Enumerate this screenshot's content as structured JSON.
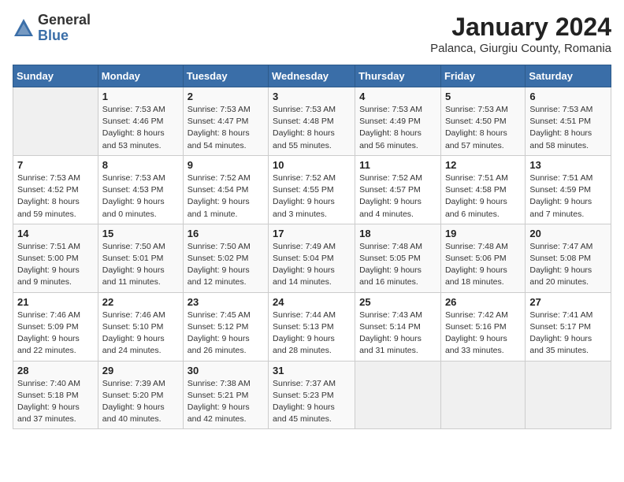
{
  "header": {
    "logo": {
      "general": "General",
      "blue": "Blue"
    },
    "title": "January 2024",
    "subtitle": "Palanca, Giurgiu County, Romania"
  },
  "calendar": {
    "days_of_week": [
      "Sunday",
      "Monday",
      "Tuesday",
      "Wednesday",
      "Thursday",
      "Friday",
      "Saturday"
    ],
    "weeks": [
      [
        {
          "day": "",
          "info": ""
        },
        {
          "day": "1",
          "info": "Sunrise: 7:53 AM\nSunset: 4:46 PM\nDaylight: 8 hours\nand 53 minutes."
        },
        {
          "day": "2",
          "info": "Sunrise: 7:53 AM\nSunset: 4:47 PM\nDaylight: 8 hours\nand 54 minutes."
        },
        {
          "day": "3",
          "info": "Sunrise: 7:53 AM\nSunset: 4:48 PM\nDaylight: 8 hours\nand 55 minutes."
        },
        {
          "day": "4",
          "info": "Sunrise: 7:53 AM\nSunset: 4:49 PM\nDaylight: 8 hours\nand 56 minutes."
        },
        {
          "day": "5",
          "info": "Sunrise: 7:53 AM\nSunset: 4:50 PM\nDaylight: 8 hours\nand 57 minutes."
        },
        {
          "day": "6",
          "info": "Sunrise: 7:53 AM\nSunset: 4:51 PM\nDaylight: 8 hours\nand 58 minutes."
        }
      ],
      [
        {
          "day": "7",
          "info": "Sunrise: 7:53 AM\nSunset: 4:52 PM\nDaylight: 8 hours\nand 59 minutes."
        },
        {
          "day": "8",
          "info": "Sunrise: 7:53 AM\nSunset: 4:53 PM\nDaylight: 9 hours\nand 0 minutes."
        },
        {
          "day": "9",
          "info": "Sunrise: 7:52 AM\nSunset: 4:54 PM\nDaylight: 9 hours\nand 1 minute."
        },
        {
          "day": "10",
          "info": "Sunrise: 7:52 AM\nSunset: 4:55 PM\nDaylight: 9 hours\nand 3 minutes."
        },
        {
          "day": "11",
          "info": "Sunrise: 7:52 AM\nSunset: 4:57 PM\nDaylight: 9 hours\nand 4 minutes."
        },
        {
          "day": "12",
          "info": "Sunrise: 7:51 AM\nSunset: 4:58 PM\nDaylight: 9 hours\nand 6 minutes."
        },
        {
          "day": "13",
          "info": "Sunrise: 7:51 AM\nSunset: 4:59 PM\nDaylight: 9 hours\nand 7 minutes."
        }
      ],
      [
        {
          "day": "14",
          "info": "Sunrise: 7:51 AM\nSunset: 5:00 PM\nDaylight: 9 hours\nand 9 minutes."
        },
        {
          "day": "15",
          "info": "Sunrise: 7:50 AM\nSunset: 5:01 PM\nDaylight: 9 hours\nand 11 minutes."
        },
        {
          "day": "16",
          "info": "Sunrise: 7:50 AM\nSunset: 5:02 PM\nDaylight: 9 hours\nand 12 minutes."
        },
        {
          "day": "17",
          "info": "Sunrise: 7:49 AM\nSunset: 5:04 PM\nDaylight: 9 hours\nand 14 minutes."
        },
        {
          "day": "18",
          "info": "Sunrise: 7:48 AM\nSunset: 5:05 PM\nDaylight: 9 hours\nand 16 minutes."
        },
        {
          "day": "19",
          "info": "Sunrise: 7:48 AM\nSunset: 5:06 PM\nDaylight: 9 hours\nand 18 minutes."
        },
        {
          "day": "20",
          "info": "Sunrise: 7:47 AM\nSunset: 5:08 PM\nDaylight: 9 hours\nand 20 minutes."
        }
      ],
      [
        {
          "day": "21",
          "info": "Sunrise: 7:46 AM\nSunset: 5:09 PM\nDaylight: 9 hours\nand 22 minutes."
        },
        {
          "day": "22",
          "info": "Sunrise: 7:46 AM\nSunset: 5:10 PM\nDaylight: 9 hours\nand 24 minutes."
        },
        {
          "day": "23",
          "info": "Sunrise: 7:45 AM\nSunset: 5:12 PM\nDaylight: 9 hours\nand 26 minutes."
        },
        {
          "day": "24",
          "info": "Sunrise: 7:44 AM\nSunset: 5:13 PM\nDaylight: 9 hours\nand 28 minutes."
        },
        {
          "day": "25",
          "info": "Sunrise: 7:43 AM\nSunset: 5:14 PM\nDaylight: 9 hours\nand 31 minutes."
        },
        {
          "day": "26",
          "info": "Sunrise: 7:42 AM\nSunset: 5:16 PM\nDaylight: 9 hours\nand 33 minutes."
        },
        {
          "day": "27",
          "info": "Sunrise: 7:41 AM\nSunset: 5:17 PM\nDaylight: 9 hours\nand 35 minutes."
        }
      ],
      [
        {
          "day": "28",
          "info": "Sunrise: 7:40 AM\nSunset: 5:18 PM\nDaylight: 9 hours\nand 37 minutes."
        },
        {
          "day": "29",
          "info": "Sunrise: 7:39 AM\nSunset: 5:20 PM\nDaylight: 9 hours\nand 40 minutes."
        },
        {
          "day": "30",
          "info": "Sunrise: 7:38 AM\nSunset: 5:21 PM\nDaylight: 9 hours\nand 42 minutes."
        },
        {
          "day": "31",
          "info": "Sunrise: 7:37 AM\nSunset: 5:23 PM\nDaylight: 9 hours\nand 45 minutes."
        },
        {
          "day": "",
          "info": ""
        },
        {
          "day": "",
          "info": ""
        },
        {
          "day": "",
          "info": ""
        }
      ]
    ]
  }
}
